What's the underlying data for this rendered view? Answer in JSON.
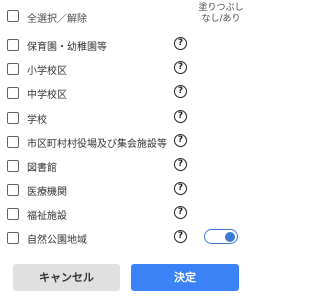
{
  "header": {
    "select_all_label": "全選択／解除",
    "column_line1": "塗りつぶし",
    "column_line2": "なし/あり"
  },
  "items": [
    {
      "label": "保育園・幼稚園等"
    },
    {
      "label": "小学校区"
    },
    {
      "label": "中学校区"
    },
    {
      "label": "学校"
    },
    {
      "label": "市区町村村役場及び集会施設等"
    },
    {
      "label": "図書館"
    },
    {
      "label": "医療機関"
    },
    {
      "label": "福祉施設"
    },
    {
      "label": "自然公園地域",
      "fill_toggle_on": true
    }
  ],
  "help_symbol": "?",
  "buttons": {
    "cancel": "キャンセル",
    "ok": "決定"
  },
  "colors": {
    "accent": "#3b82f6",
    "toggle": "#3b7bd4",
    "cancel_bg": "#e0e0e0"
  }
}
